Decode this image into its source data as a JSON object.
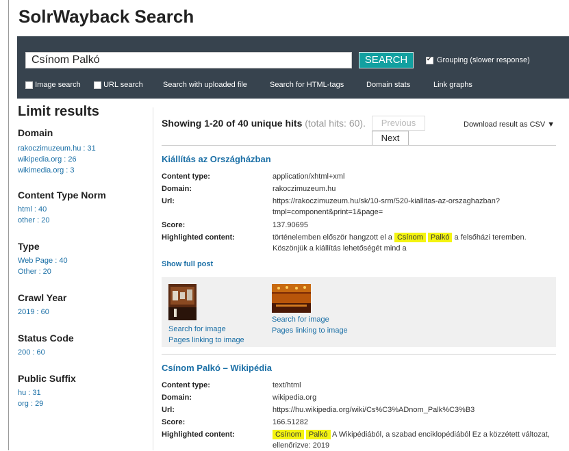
{
  "app": {
    "title": "SolrWayback Search"
  },
  "search": {
    "query": "Csínom Palkó",
    "button": "SEARCH",
    "grouping_label": "Grouping (slower response)",
    "grouping_checked": true
  },
  "toolbar": {
    "image_search": "Image search",
    "url_search": "URL search",
    "uploaded_file": "Search with uploaded file",
    "html_tags": "Search for HTML-tags",
    "domain_stats": "Domain stats",
    "link_graphs": "Link graphs"
  },
  "sidebar": {
    "title": "Limit results",
    "facets": [
      {
        "name": "Domain",
        "values": [
          "rakoczimuzeum.hu : 31",
          "wikipedia.org : 26",
          "wikimedia.org : 3"
        ]
      },
      {
        "name": "Content Type Norm",
        "values": [
          "html : 40",
          "other : 20"
        ]
      },
      {
        "name": "Type",
        "values": [
          "Web Page : 40",
          "Other : 20"
        ]
      },
      {
        "name": "Crawl Year",
        "values": [
          "2019 : 60"
        ]
      },
      {
        "name": "Status Code",
        "values": [
          "200 : 60"
        ]
      },
      {
        "name": "Public Suffix",
        "values": [
          "hu : 31",
          "org : 29"
        ]
      }
    ]
  },
  "results_header": {
    "showing": "Showing 1-20 of 40 unique hits",
    "total": "(total hits: 60).",
    "previous": "Previous",
    "next": "Next",
    "download": "Download result as CSV ▼"
  },
  "labels": {
    "content_type": "Content type:",
    "domain": "Domain:",
    "url": "Url:",
    "score": "Score:",
    "highlighted": "Highlighted content:"
  },
  "results": [
    {
      "title": "Kiállítás az Országházban",
      "content_type": "application/xhtml+xml",
      "domain": "rakoczimuzeum.hu",
      "url_line1": "https://rakoczimuzeum.hu/sk/10-srm/520-kiallitas-az-orszaghazban?",
      "url_line2": "tmpl=component&print=1&page=",
      "score": "137.90695",
      "hl_pre": "történelemben először hangzott el a",
      "hl_word1": "Csínom",
      "hl_word2": "Palkó",
      "hl_post": "a felsőházi teremben.",
      "hl_line2": "Köszönjük a kiállítás lehetőségét mind a",
      "show_full": "Show full post",
      "images": [
        {
          "search": "Search for image",
          "linking": "Pages linking to image"
        },
        {
          "search": "Search for image",
          "linking": "Pages linking to image"
        }
      ]
    },
    {
      "title": "Csínom Palkó – Wikipédia",
      "content_type": "text/html",
      "domain": "wikipedia.org",
      "url_line1": "https://hu.wikipedia.org/wiki/Cs%C3%ADnom_Palk%C3%B3",
      "score": "166.51282",
      "hl_word1": "Csínom",
      "hl_word2": "Palkó",
      "hl_post": "A Wikipédiából, a szabad enciklopédiából Ez a közzétett változat,",
      "hl_line2": "ellenőrizve: 2019"
    }
  ]
}
